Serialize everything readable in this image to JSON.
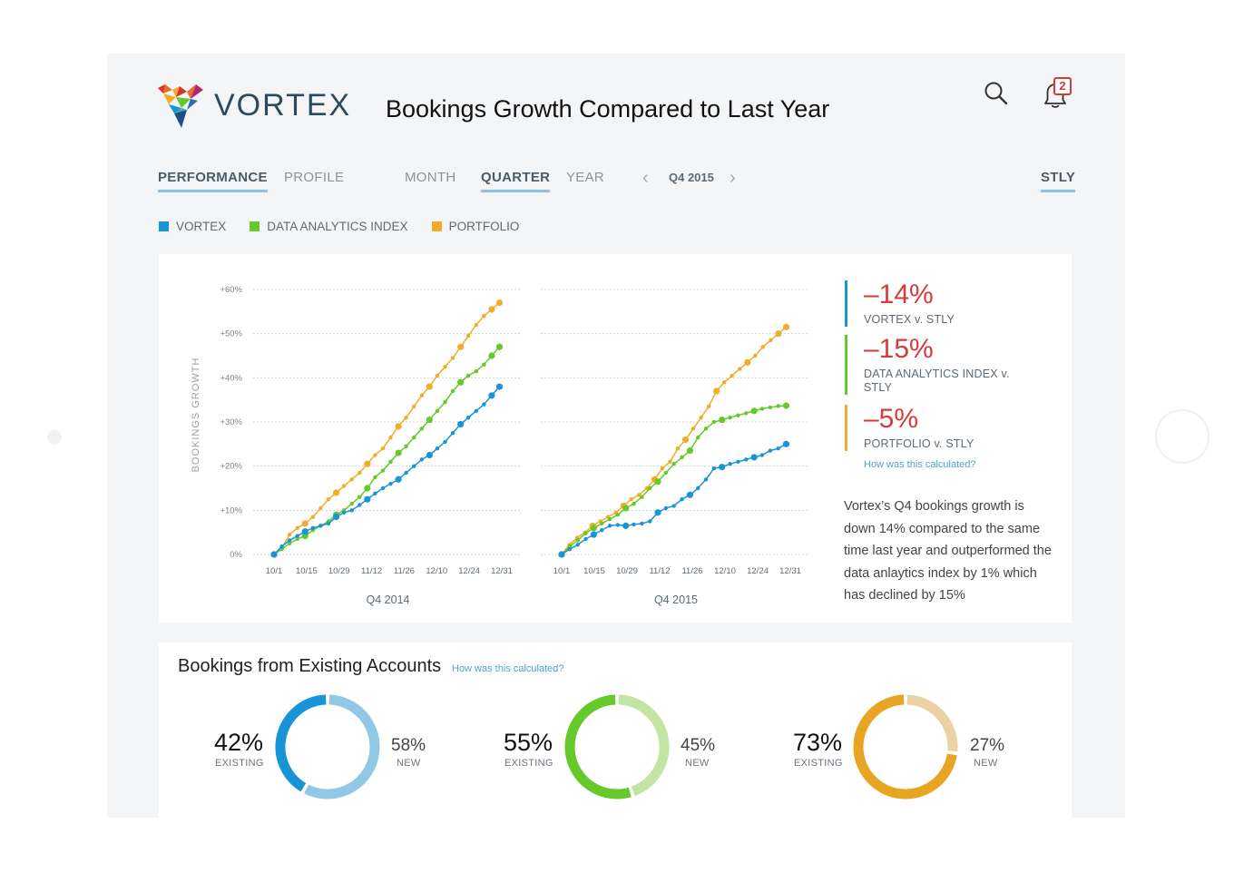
{
  "app": {
    "name": "VORTEX"
  },
  "header": {
    "title": "Bookings Growth Compared to Last Year",
    "notification_count": "2"
  },
  "nav": {
    "tabs": [
      {
        "label": "PERFORMANCE",
        "active": true
      },
      {
        "label": "PROFILE",
        "active": false
      }
    ],
    "period_tabs": [
      {
        "label": "MONTH",
        "active": false
      },
      {
        "label": "QUARTER",
        "active": true
      },
      {
        "label": "YEAR",
        "active": false
      }
    ],
    "period_value": "Q4 2015",
    "stly_label": "STLY"
  },
  "legend": [
    {
      "label": "VORTEX",
      "color": "#1a94d9"
    },
    {
      "label": "DATA ANALYTICS INDEX",
      "color": "#66c92a"
    },
    {
      "label": "PORTFOLIO",
      "color": "#f0ad2c"
    }
  ],
  "chart_data": [
    {
      "type": "line",
      "title": "Q4 2014",
      "ylabel": "BOOKINGS GROWTH",
      "ylim": [
        0,
        60
      ],
      "y_ticks": [
        "0%",
        "+10%",
        "+20%",
        "+30%",
        "+40%",
        "+50%",
        "+60%"
      ],
      "x_ticks": [
        "10/1",
        "10/15",
        "10/29",
        "11/12",
        "11/26",
        "12/10",
        "12/24",
        "12/31"
      ],
      "series": [
        {
          "name": "VORTEX",
          "color": "#1a94d9",
          "values": [
            0,
            1.8,
            3.2,
            4.2,
            5.2,
            6.0,
            6.5,
            7.0,
            8.5,
            9.5,
            10.0,
            11.2,
            12.5,
            13.8,
            15.0,
            16.0,
            17.0,
            18.5,
            20.0,
            21.5,
            22.5,
            24.0,
            25.5,
            27.5,
            29.5,
            31.0,
            32.5,
            34.0,
            36.0,
            38.0
          ]
        },
        {
          "name": "DATA ANALYTICS INDEX",
          "color": "#66c92a",
          "values": [
            0,
            1.2,
            2.5,
            3.5,
            4.2,
            5.5,
            6.5,
            7.5,
            9.0,
            10.0,
            11.5,
            13.0,
            15.0,
            17.5,
            19.0,
            21.0,
            23.0,
            24.5,
            26.5,
            28.5,
            30.5,
            32.5,
            34.5,
            37.0,
            39.0,
            40.5,
            41.5,
            43.0,
            45.0,
            47.0
          ]
        },
        {
          "name": "PORTFOLIO",
          "color": "#f0ad2c",
          "values": [
            0,
            1.5,
            4.5,
            6.0,
            7.0,
            8.5,
            10.5,
            12.5,
            14.0,
            15.5,
            17.0,
            18.5,
            20.5,
            22.5,
            24.0,
            26.5,
            29.0,
            31.0,
            33.5,
            36.0,
            38.0,
            40.5,
            42.5,
            44.5,
            47.0,
            49.5,
            52.0,
            54.0,
            55.5,
            57.0
          ]
        }
      ]
    },
    {
      "type": "line",
      "title": "Q4 2015",
      "ylim": [
        0,
        60
      ],
      "x_ticks": [
        "10/1",
        "10/15",
        "10/29",
        "11/12",
        "11/26",
        "12/10",
        "12/24",
        "12/31"
      ],
      "series": [
        {
          "name": "VORTEX",
          "color": "#1a94d9",
          "values": [
            0,
            1.2,
            2.2,
            3.5,
            4.5,
            5.5,
            6.5,
            6.7,
            6.5,
            6.8,
            7.0,
            7.5,
            9.5,
            10.5,
            11.0,
            12.5,
            13.5,
            15.0,
            17.0,
            19.5,
            19.8,
            20.5,
            21.0,
            21.5,
            22.0,
            22.5,
            23.5,
            24.0,
            25.0
          ]
        },
        {
          "name": "DATA ANALYTICS INDEX",
          "color": "#66c92a",
          "values": [
            0,
            1.8,
            3.2,
            4.8,
            6.0,
            7.0,
            8.0,
            9.0,
            10.5,
            11.5,
            13.0,
            15.0,
            16.5,
            18.5,
            20.5,
            22.0,
            23.5,
            26.5,
            28.5,
            30.0,
            30.5,
            31.0,
            31.5,
            32.0,
            32.5,
            33.0,
            33.3,
            33.6,
            33.7
          ]
        },
        {
          "name": "PORTFOLIO",
          "color": "#f0ad2c",
          "values": [
            0,
            2.2,
            3.8,
            5.0,
            6.5,
            7.5,
            8.5,
            9.5,
            11.0,
            12.5,
            13.5,
            15.0,
            17.0,
            19.5,
            21.0,
            24.0,
            26.0,
            28.5,
            31.0,
            33.5,
            37.0,
            39.0,
            40.5,
            42.0,
            43.5,
            45.0,
            47.0,
            48.5,
            50.0,
            51.5
          ]
        }
      ]
    },
    {
      "type": "pie",
      "slices": [
        {
          "label": "EXISTING",
          "value": 42,
          "color": "#1a94d9"
        },
        {
          "label": "NEW",
          "value": 58,
          "color": "#90c8e6"
        }
      ]
    },
    {
      "type": "pie",
      "slices": [
        {
          "label": "EXISTING",
          "value": 55,
          "color": "#66c92a"
        },
        {
          "label": "NEW",
          "value": 45,
          "color": "#c4e4a4"
        }
      ]
    },
    {
      "type": "pie",
      "slices": [
        {
          "label": "EXISTING",
          "value": 73,
          "color": "#e8a524"
        },
        {
          "label": "NEW",
          "value": 27,
          "color": "#ebd1a3"
        }
      ]
    }
  ],
  "stats": [
    {
      "pct": "–14%",
      "label": "VORTEX v. STLY",
      "color": "#1a94d9"
    },
    {
      "pct": "–15%",
      "label": "DATA ANALYTICS INDEX v. STLY",
      "color": "#66c92a"
    },
    {
      "pct": "–5%",
      "label": "PORTFOLIO v. STLY",
      "color": "#f0ad2c"
    }
  ],
  "calc_link": "How was this calculated?",
  "summary": "Vortex’s Q4 bookings growth is down 14% compared to the same time last year and outperformed the data anlaytics index by 1% which has declined by 15%",
  "existing": {
    "title": "Bookings from Existing Accounts",
    "calc_link": "How was this calculated?",
    "donuts": [
      {
        "existing_pct": "42%",
        "existing_label": "EXISTING",
        "new_pct": "58%",
        "new_label": "NEW"
      },
      {
        "existing_pct": "55%",
        "existing_label": "EXISTING",
        "new_pct": "45%",
        "new_label": "NEW"
      },
      {
        "existing_pct": "73%",
        "existing_label": "EXISTING",
        "new_pct": "27%",
        "new_label": "NEW"
      }
    ]
  }
}
